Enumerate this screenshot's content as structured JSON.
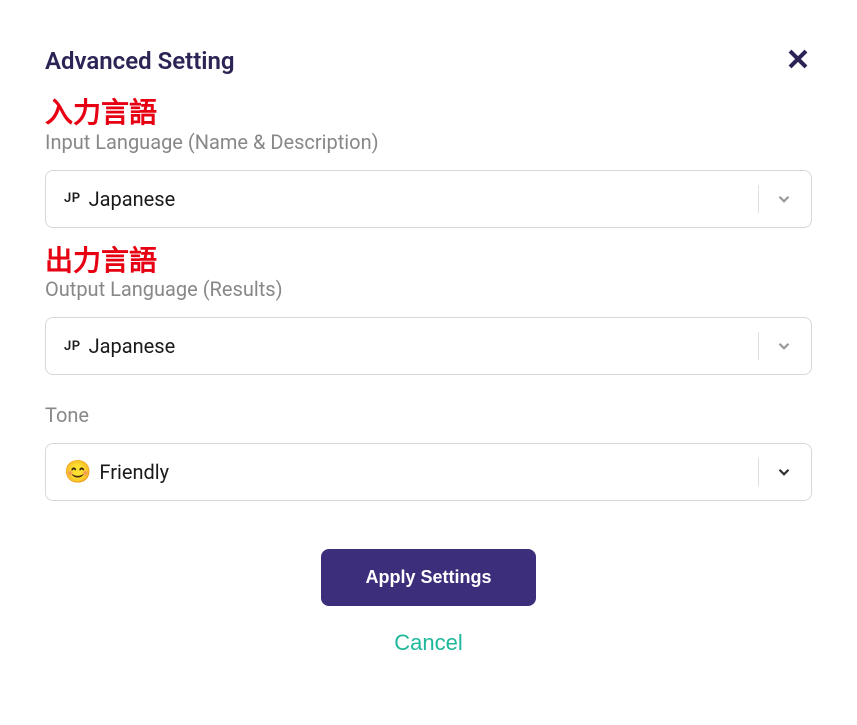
{
  "header": {
    "title": "Advanced Setting"
  },
  "inputLanguage": {
    "labelJp": "入力言語",
    "labelEn": "Input Language (Name & Description)",
    "code": "JP",
    "value": "Japanese"
  },
  "outputLanguage": {
    "labelJp": "出力言語",
    "labelEn": "Output Language (Results)",
    "code": "JP",
    "value": "Japanese"
  },
  "tone": {
    "label": "Tone",
    "emoji": "😊",
    "value": "Friendly"
  },
  "actions": {
    "apply": "Apply Settings",
    "cancel": "Cancel"
  }
}
